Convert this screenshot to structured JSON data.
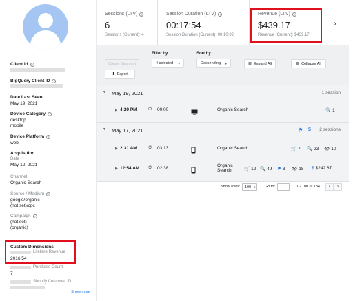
{
  "profile": {
    "client_id_label": "Client Id",
    "bq_client_id_label": "BigQuery Client ID",
    "date_last_seen_label": "Date Last Seen",
    "date_last_seen_value": "May 19, 2021",
    "device_category_label": "Device Category",
    "device_category_values": [
      "desktop",
      "mobile"
    ],
    "device_platform_label": "Device Platform",
    "device_platform_value": "web",
    "acquisition_label": "Acquisition",
    "acquisition_date_label": "Date",
    "acquisition_date_value": "May 12, 2021",
    "channel_label": "Channel",
    "channel_value": "Organic Search",
    "source_medium_label": "Source / Medium",
    "source_medium_values": [
      "google/organic",
      "(not set)/cpc"
    ],
    "campaign_label": "Campaign",
    "campaign_values": [
      "(not set)",
      "(organic)"
    ],
    "custom_dimensions_label": "Custom Dimensions",
    "lifetime_revenue_label": "Lifetime Revenue",
    "lifetime_revenue_value": "2016.54",
    "purchase_count_label": "Purchase Count",
    "purchase_count_value": "7",
    "shopify_customer_id_label": "Shopify Customer ID",
    "show_more": "Show more"
  },
  "metrics": [
    {
      "title": "Sessions (LTV)",
      "value": "6",
      "sub": "Sessions (Current): 4"
    },
    {
      "title": "Session Duration (LTV)",
      "value": "00:17:54",
      "sub": "Session Duration (Current): 00:10:02"
    },
    {
      "title": "Revenue (LTV)",
      "value": "$439.17",
      "sub": "Revenue (Current): $439.17"
    }
  ],
  "toolbar": {
    "create_segment": "Create Segment",
    "export": "Export",
    "filter_by_label": "Filter by",
    "filter_by_value": "4 selected",
    "sort_by_label": "Sort by",
    "sort_by_value": "Descending",
    "expand_all": "Expand All",
    "collapse_all": "Collapse All"
  },
  "days": [
    {
      "date": "May 19, 2021",
      "count": "1 session",
      "sessions": [
        {
          "time": "4:29 PM",
          "duration": "00:00",
          "device": "desktop",
          "channel": "Organic Search",
          "search_count": "1"
        }
      ]
    },
    {
      "date": "May 17, 2021",
      "count": "2 sessions",
      "sessions": [
        {
          "time": "2:31 AM",
          "duration": "03:13",
          "device": "mobile",
          "channel": "Organic Search",
          "cart": "7",
          "search_count": "23",
          "views": "10"
        },
        {
          "time": "12:54 AM",
          "duration": "02:38",
          "device": "mobile",
          "channel": "Organic Search",
          "cart": "12",
          "search_count": "49",
          "flags": "3",
          "views": "18",
          "revenue": "$242.67"
        }
      ]
    }
  ],
  "pager": {
    "show_rows_label": "Show rows:",
    "rows_value": "100",
    "goto_label": "Go to:",
    "goto_value": "1",
    "range": "1 - 100 of 184"
  },
  "colors": {
    "accent": "#1a73e8",
    "highlight": "#e0101c",
    "avatar": "#a5c6f3"
  }
}
